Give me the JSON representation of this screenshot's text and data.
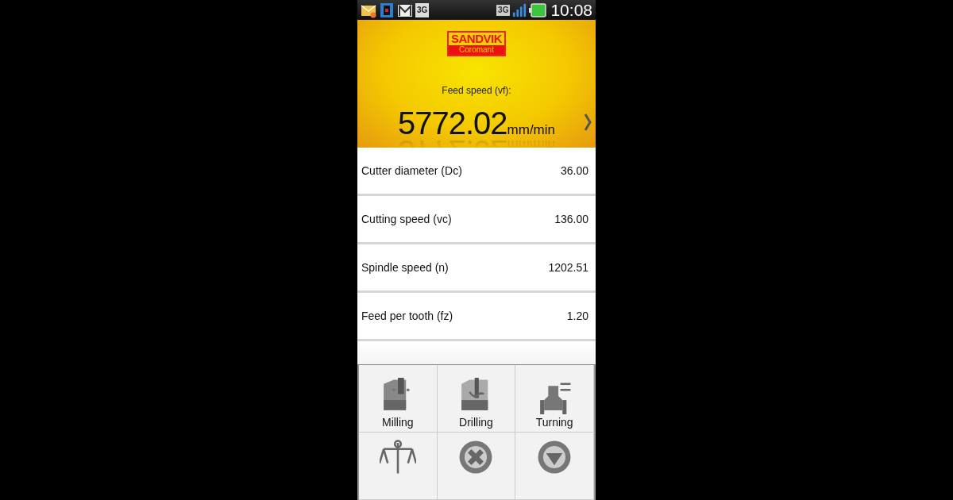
{
  "status_bar": {
    "notification_badge": "3G",
    "network": "3G",
    "time": "10:08"
  },
  "header": {
    "logo": {
      "line_1": "SANDVIK",
      "line_2": "Coromant"
    },
    "label": "Feed speed (vf):",
    "value": "5772.02",
    "unit": "mm/min"
  },
  "rows": [
    {
      "label": "Cutter diameter (Dc)",
      "value": "36.00"
    },
    {
      "label": "Cutting speed (vc)",
      "value": "136.00"
    },
    {
      "label": "Spindle speed (n)",
      "value": "1202.51"
    },
    {
      "label": "Feed per tooth (fz)",
      "value": "1.20"
    }
  ],
  "menu": [
    {
      "kind": "milling",
      "label": "Milling"
    },
    {
      "kind": "drilling",
      "label": "Drilling"
    },
    {
      "kind": "turning",
      "label": "Turning"
    },
    {
      "kind": "scale"
    },
    {
      "kind": "close"
    },
    {
      "kind": "down"
    }
  ]
}
